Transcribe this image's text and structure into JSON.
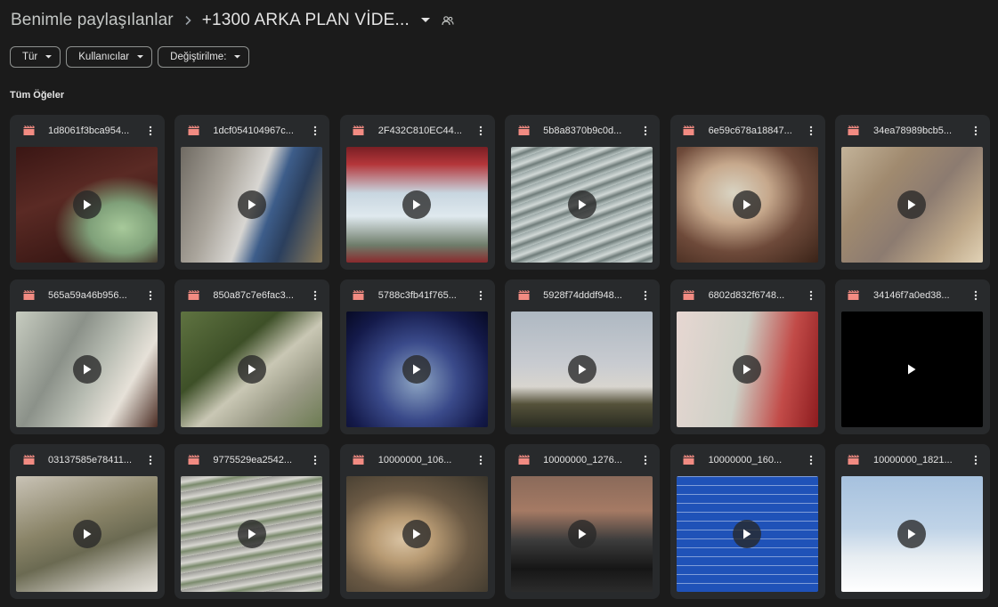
{
  "header": {
    "root_label": "Benimle paylaşılanlar",
    "folder_title": "+1300 ARKA PLAN VİDE...",
    "separator_icon": "chevron-right-icon",
    "dropdown_icon": "caret-down-icon",
    "shared_icon": "shared-folder-icon"
  },
  "filters": [
    {
      "label": "Tür"
    },
    {
      "label": "Kullanıcılar"
    },
    {
      "label": "Değiştirilme:"
    }
  ],
  "section_title": "Tüm Öğeler",
  "colors": {
    "background": "#1b1b1b",
    "card": "#282a2c",
    "video_icon": "#f28b82",
    "text": "#e3e3e3"
  },
  "files": [
    {
      "name": "1d8061f3bca954...",
      "thumb": "cash-in-hand-dark"
    },
    {
      "name": "1dcf054104967c...",
      "thumb": "atm-cash"
    },
    {
      "name": "2F432C810EC44...",
      "thumb": "red-window-frame"
    },
    {
      "name": "5b8a8370b9c0d...",
      "thumb": "money-stacks"
    },
    {
      "name": "6e59c678a18847...",
      "thumb": "cash-fan-hand"
    },
    {
      "name": "34ea78989bcb5...",
      "thumb": "blurred-cash"
    },
    {
      "name": "565a59a46b956...",
      "thumb": "money-pile-woman"
    },
    {
      "name": "850a87c7e6fac3...",
      "thumb": "cash-outdoors"
    },
    {
      "name": "5788c3fb41f765...",
      "thumb": "cash-blue-light"
    },
    {
      "name": "5928f74dddf948...",
      "thumb": "castle-wall-sky"
    },
    {
      "name": "6802d832f6748...",
      "thumb": "cash-red-background"
    },
    {
      "name": "34146f7a0ed38...",
      "thumb": "black-frame"
    },
    {
      "name": "03137585e78411...",
      "thumb": "rolled-cash-bundle"
    },
    {
      "name": "9775529ea2542...",
      "thumb": "printing-money-sheets"
    },
    {
      "name": "10000000_106...",
      "thumb": "cut-log"
    },
    {
      "name": "10000000_1276...",
      "thumb": "black-truck"
    },
    {
      "name": "10000000_160...",
      "thumb": "blue-tile-pool"
    },
    {
      "name": "10000000_1821...",
      "thumb": "motorbike-snow"
    }
  ]
}
